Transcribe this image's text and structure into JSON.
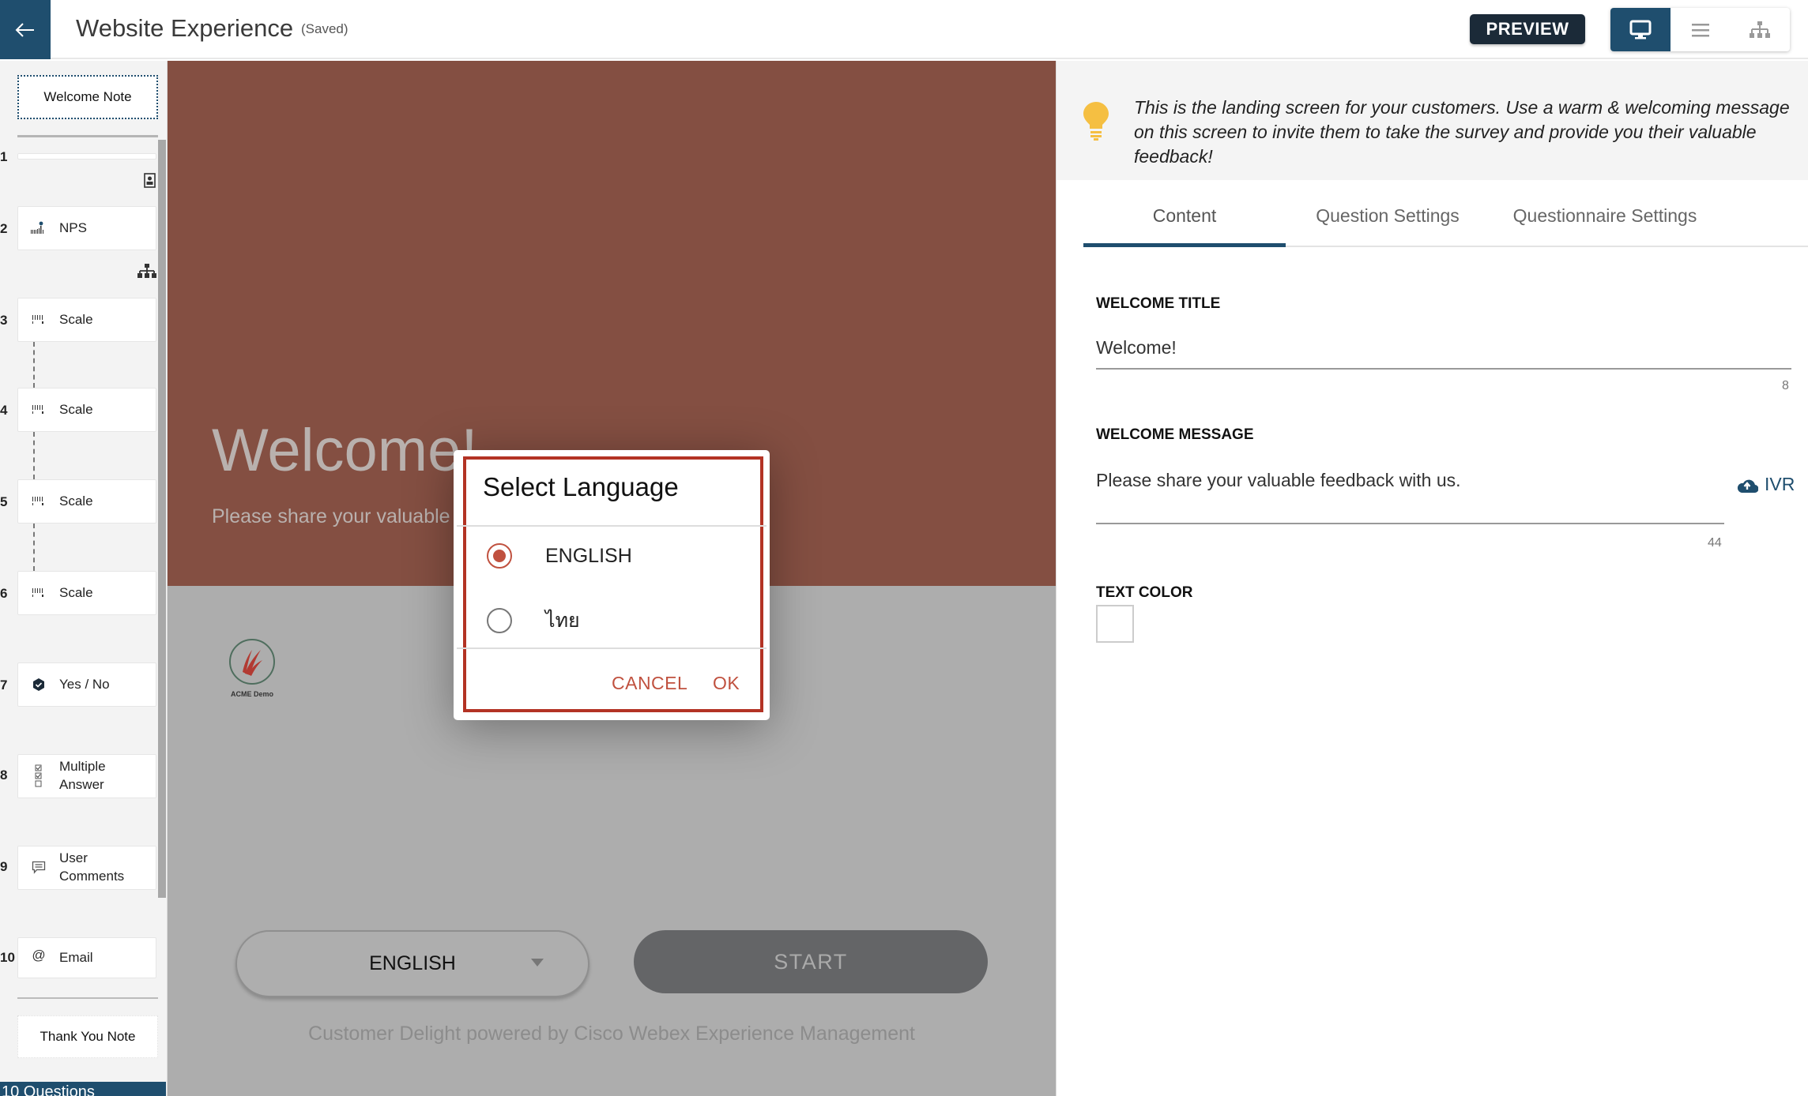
{
  "header": {
    "title": "Website Experience",
    "saved_status": "(Saved)",
    "preview_label": "PREVIEW",
    "view_modes": [
      {
        "icon": "desktop-icon",
        "active": true
      },
      {
        "icon": "list-icon",
        "active": false
      },
      {
        "icon": "hierarchy-icon",
        "active": false
      }
    ]
  },
  "sidebar": {
    "welcome_note": "Welcome Note",
    "thank_you_note": "Thank You Note",
    "questions_count": "10 Questions",
    "items": [
      {
        "num": "1",
        "label": "",
        "icon": ""
      },
      {
        "num": "2",
        "label": "NPS",
        "icon": "nps-icon"
      },
      {
        "num": "3",
        "label": "Scale",
        "icon": "scale-icon"
      },
      {
        "num": "4",
        "label": "Scale",
        "icon": "scale-icon"
      },
      {
        "num": "5",
        "label": "Scale",
        "icon": "scale-icon"
      },
      {
        "num": "6",
        "label": "Scale",
        "icon": "scale-icon"
      },
      {
        "num": "7",
        "label": "Yes / No",
        "icon": "yes-no-icon"
      },
      {
        "num": "8",
        "label": "Multiple Answer",
        "icon": "multiple-answer-icon"
      },
      {
        "num": "9",
        "label": "User Comments",
        "icon": "comment-icon"
      },
      {
        "num": "10",
        "label": "Email",
        "icon": "at-icon"
      }
    ]
  },
  "preview": {
    "title": "Welcome!",
    "message": "Please share your valuable feedback with us.",
    "logo_text": "ACME Demo",
    "language_selected": "ENGLISH",
    "start_label": "START",
    "powered_by": "Customer Delight powered by Cisco Webex Experience Management",
    "band_color": "#844f42"
  },
  "dialog": {
    "title": "Select Language",
    "options": [
      {
        "label": "ENGLISH",
        "selected": true
      },
      {
        "label": "ไทย",
        "selected": false
      }
    ],
    "cancel_label": "CANCEL",
    "ok_label": "OK",
    "accent_color": "#c0513f"
  },
  "right_panel": {
    "tip": "This is the landing screen for your customers. Use a warm & welcoming message on this screen to invite them to take the survey and provide you their valuable feedback!",
    "tabs": [
      {
        "label": "Content",
        "active": true
      },
      {
        "label": "Question Settings",
        "active": false
      },
      {
        "label": "Questionnaire Settings",
        "active": false
      }
    ],
    "welcome_title_label": "WELCOME TITLE",
    "welcome_title_value": "Welcome!",
    "welcome_title_count": "8",
    "welcome_message_label": "WELCOME MESSAGE",
    "welcome_message_value": "Please share your valuable feedback with us.",
    "welcome_message_count": "44",
    "ivr_label": "IVR",
    "text_color_label": "TEXT COLOR",
    "text_color_value": "#ffffff"
  }
}
